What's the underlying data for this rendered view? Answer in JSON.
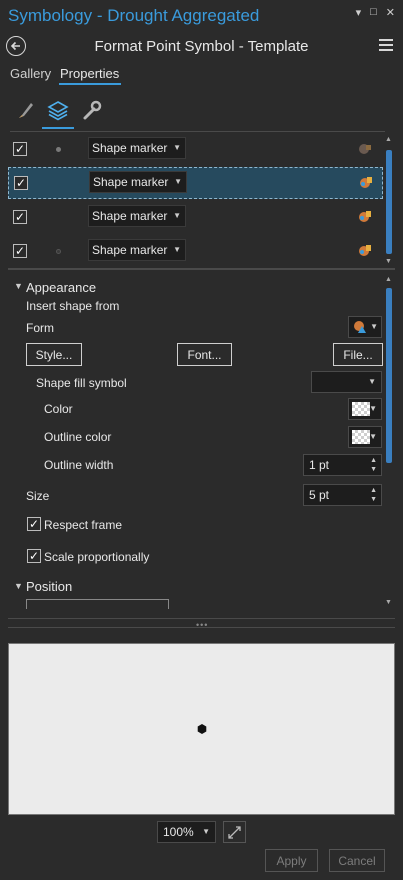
{
  "pane": {
    "title": "Symbology - Drought Aggregated"
  },
  "header": {
    "title": "Format Point Symbol - Template"
  },
  "tabs": [
    {
      "label": "Gallery"
    },
    {
      "label": "Properties"
    }
  ],
  "subtabs": [
    {
      "icon": "paintbrush-icon"
    },
    {
      "icon": "layers-icon"
    },
    {
      "icon": "wrench-icon"
    }
  ],
  "layers": [
    {
      "checked": true,
      "type": "Shape marker",
      "selected": false
    },
    {
      "checked": true,
      "type": "Shape marker",
      "selected": true
    },
    {
      "checked": true,
      "type": "Shape marker",
      "selected": false
    },
    {
      "checked": true,
      "type": "Shape marker",
      "selected": false
    }
  ],
  "appearance": {
    "section_label": "Appearance",
    "insert_shape_label": "Insert shape from",
    "form_label": "Form",
    "style_button": "Style...",
    "font_button": "Font...",
    "file_button": "File...",
    "shape_fill_label": "Shape fill symbol",
    "shape_fill_value": "",
    "color_label": "Color",
    "outline_color_label": "Outline color",
    "outline_width_label": "Outline width",
    "outline_width_value": "1 pt",
    "size_label": "Size",
    "size_value": "5 pt",
    "respect_frame_label": "Respect frame",
    "respect_frame_checked": true,
    "scale_prop_label": "Scale proportionally",
    "scale_prop_checked": true
  },
  "position": {
    "section_label": "Position"
  },
  "footer": {
    "zoom_value": "100%",
    "apply_button": "Apply",
    "cancel_button": "Cancel"
  },
  "colors": {
    "accent": "#3a9bdc",
    "background": "#2b2b2b",
    "selection": "#264a5e"
  }
}
